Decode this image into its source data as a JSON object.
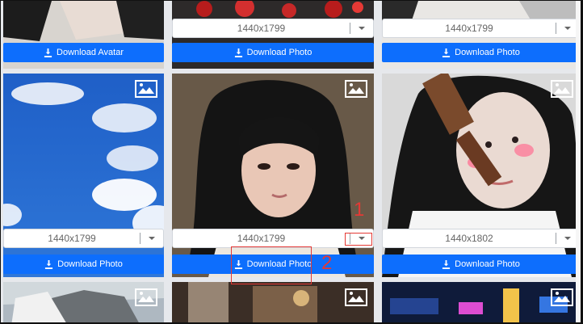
{
  "top_row": {
    "left_button": "Download Avatar",
    "center_size": "1440x1799",
    "center_button": "Download Photo",
    "right_size": "1440x1799",
    "right_button": "Download Photo"
  },
  "middle_row": {
    "left_size": "1440x1799",
    "left_button": "Download Photo",
    "center_size": "1440x1799",
    "center_button": "Download Photo",
    "right_size": "1440x1802",
    "right_button": "Download Photo"
  },
  "annotations": {
    "first": "1",
    "second": "2"
  },
  "colors": {
    "accent": "#0d6efd",
    "annotation": "#e53935"
  }
}
